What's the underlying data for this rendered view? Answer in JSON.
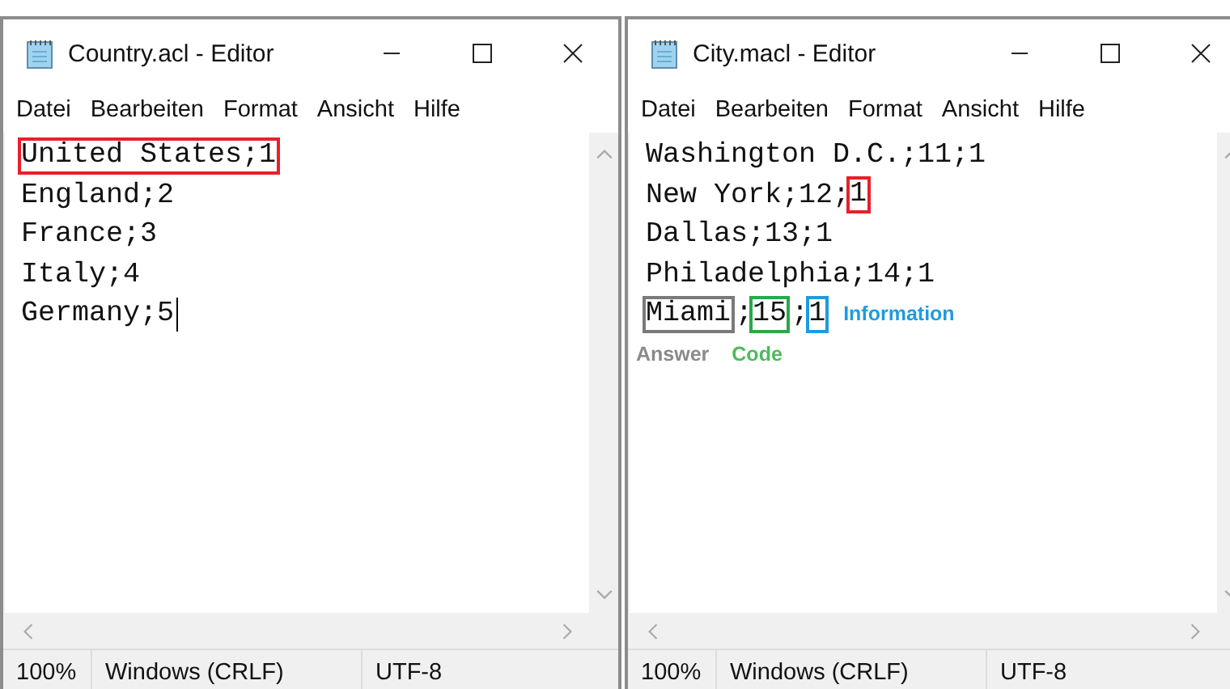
{
  "windows": [
    {
      "title": "Country.acl - Editor",
      "menu": [
        "Datei",
        "Bearbeiten",
        "Format",
        "Ansicht",
        "Hilfe"
      ],
      "lines": [
        {
          "cursor": false,
          "segments": [
            {
              "kind": "text",
              "text": "United States;1",
              "color": "#e8202a"
            }
          ]
        },
        {
          "cursor": false,
          "segments": [
            {
              "kind": "text",
              "text": "England;2"
            }
          ]
        },
        {
          "cursor": false,
          "segments": [
            {
              "kind": "text",
              "text": "France;3"
            }
          ]
        },
        {
          "cursor": false,
          "segments": [
            {
              "kind": "text",
              "text": "Italy;4"
            }
          ]
        },
        {
          "cursor": true,
          "segments": [
            {
              "kind": "text",
              "text": "Germany;5"
            }
          ]
        }
      ],
      "status": {
        "zoom": "100%",
        "line_ending": "Windows (CRLF)",
        "encoding": "UTF-8"
      }
    },
    {
      "title": "City.macl - Editor",
      "menu": [
        "Datei",
        "Bearbeiten",
        "Format",
        "Ansicht",
        "Hilfe"
      ],
      "lines": [
        {
          "cursor": false,
          "segments": [
            {
              "kind": "text",
              "text": "Washington D.C.;11;1"
            }
          ]
        },
        {
          "cursor": false,
          "segments": [
            {
              "kind": "text",
              "text": "New York;12;"
            },
            {
              "kind": "text",
              "text": "1",
              "color": "#e8202a"
            }
          ]
        },
        {
          "cursor": false,
          "segments": [
            {
              "kind": "text",
              "text": "Dallas;13;1"
            }
          ]
        },
        {
          "cursor": false,
          "segments": [
            {
              "kind": "text",
              "text": "Philadelphia;14;1"
            }
          ]
        },
        {
          "cursor": false,
          "segments": [
            {
              "kind": "text",
              "text": "Miami",
              "color": "#7a7a7a"
            },
            {
              "kind": "text",
              "text": ";"
            },
            {
              "kind": "text",
              "text": "15",
              "color": "#2aa84a"
            },
            {
              "kind": "text",
              "text": ";"
            },
            {
              "kind": "text",
              "text": "1",
              "color": "#1e9be0"
            },
            {
              "kind": "label",
              "text": "Information",
              "color": "#1e9be0"
            }
          ]
        },
        {
          "cursor": false,
          "segments": [
            {
              "kind": "label",
              "text": "Answer",
              "color": "#8a8a8a"
            },
            {
              "kind": "label",
              "text": "Code",
              "color": "#4cbb5c"
            }
          ]
        }
      ],
      "status": {
        "zoom": "100%",
        "line_ending": "Windows (CRLF)",
        "encoding": "UTF-8"
      }
    }
  ]
}
